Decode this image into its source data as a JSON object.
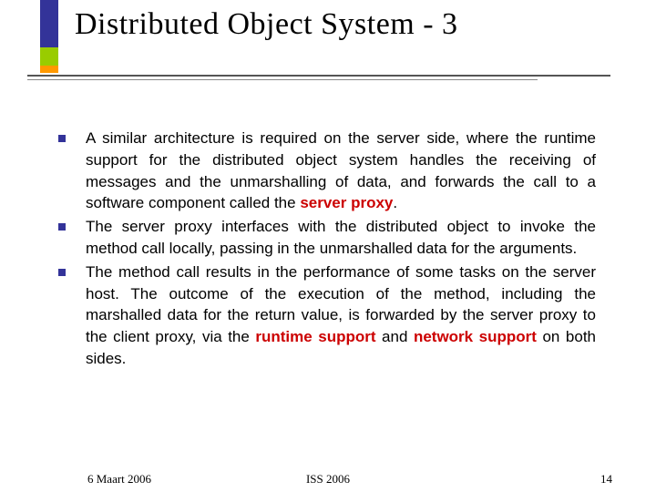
{
  "title": "Distributed Object System - 3",
  "bullets": [
    {
      "pre": "A similar architecture is required on the server side, where the runtime support for the distributed object system handles the receiving of messages and the unmarshalling of data, and forwards the call to a software component called the ",
      "hl1": "server proxy",
      "post": "."
    },
    {
      "pre": "The server proxy interfaces with the distributed object to invoke the method call locally, passing in the unmarshalled data for the arguments.",
      "hl1": "",
      "post": ""
    },
    {
      "pre": "The method call results in the performance of some tasks on the server host.  The outcome of the execution of the method, including the marshalled data for the return value, is forwarded by the server proxy to the client proxy, via the ",
      "hl1": "runtime support",
      "mid": " and ",
      "hl2": "network support",
      "post": " on both sides."
    }
  ],
  "footer": {
    "date": "6 Maart 2006",
    "center": "ISS 2006",
    "page": "14"
  }
}
